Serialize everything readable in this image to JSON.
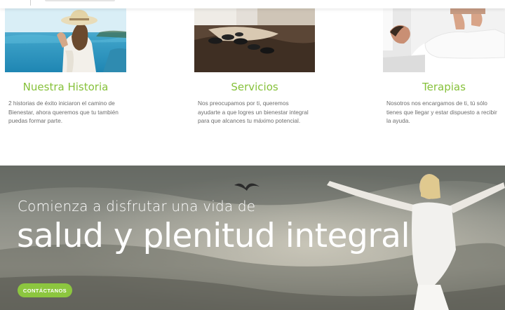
{
  "columns": [
    {
      "title": "Nuestra Historia",
      "text": "2 historias de éxito iniciaron el camino de Bienestar, ahora queremos que tu también puedas formar parte."
    },
    {
      "title": "Servicios",
      "text": "Nos preocupamos por ti, queremos ayudarte a que logres un bienestar integral para que alcances tu máximo potencial."
    },
    {
      "title": "Terapias",
      "text": "Nosotros nos encargamos de ti, tú sólo tienes que llegar y estar dispuesto a recibir la ayuda."
    }
  ],
  "hero": {
    "subtitle": "Comienza a disfrutar una vida de",
    "title": "salud y plenitud integral",
    "cta": "CONTÁCTANOS"
  },
  "colors": {
    "accent_green": "#86c13a",
    "button_green": "#8cc63f"
  }
}
